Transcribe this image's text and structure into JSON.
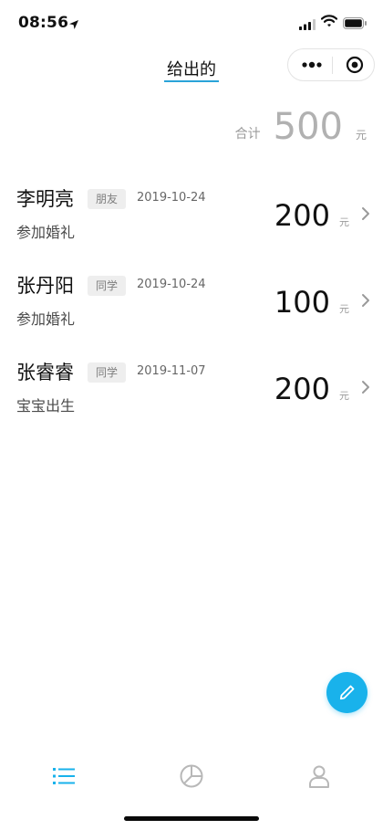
{
  "status_bar": {
    "time": "08:56"
  },
  "header": {
    "title": "给出的"
  },
  "summary": {
    "total_label": "合计",
    "total_value": "500",
    "unit": "元"
  },
  "records": [
    {
      "name": "李明亮",
      "relation": "朋友",
      "date": "2019-10-24",
      "event": "参加婚礼",
      "amount": "200",
      "unit": "元"
    },
    {
      "name": "张丹阳",
      "relation": "同学",
      "date": "2019-10-24",
      "event": "参加婚礼",
      "amount": "100",
      "unit": "元"
    },
    {
      "name": "张睿睿",
      "relation": "同学",
      "date": "2019-11-07",
      "event": "宝宝出生",
      "amount": "200",
      "unit": "元"
    }
  ],
  "tabbar": {
    "tabs": [
      {
        "icon": "list-icon",
        "active": true
      },
      {
        "icon": "pie-chart-icon",
        "active": false
      },
      {
        "icon": "user-icon",
        "active": false
      }
    ]
  },
  "colors": {
    "accent": "#19b2eb",
    "title_underline": "#2aa3d8",
    "inactive_icon": "#b8b8b8"
  }
}
